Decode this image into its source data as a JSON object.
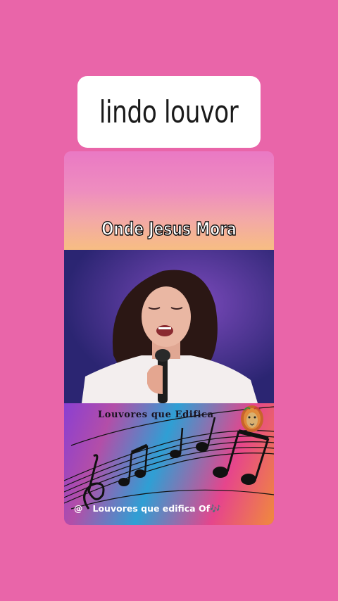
{
  "caption": {
    "text": "lindo louvor"
  },
  "video": {
    "title": "Onde Jesus Mora",
    "brand": "Louvores que Edifica",
    "handle_at": "@",
    "handle": "Louvores que edifica Of🎶"
  },
  "colors": {
    "background": "#e965a9",
    "caption_bg": "#ffffff"
  },
  "icons": [
    "lion-logo-icon",
    "music-notes-icon"
  ]
}
